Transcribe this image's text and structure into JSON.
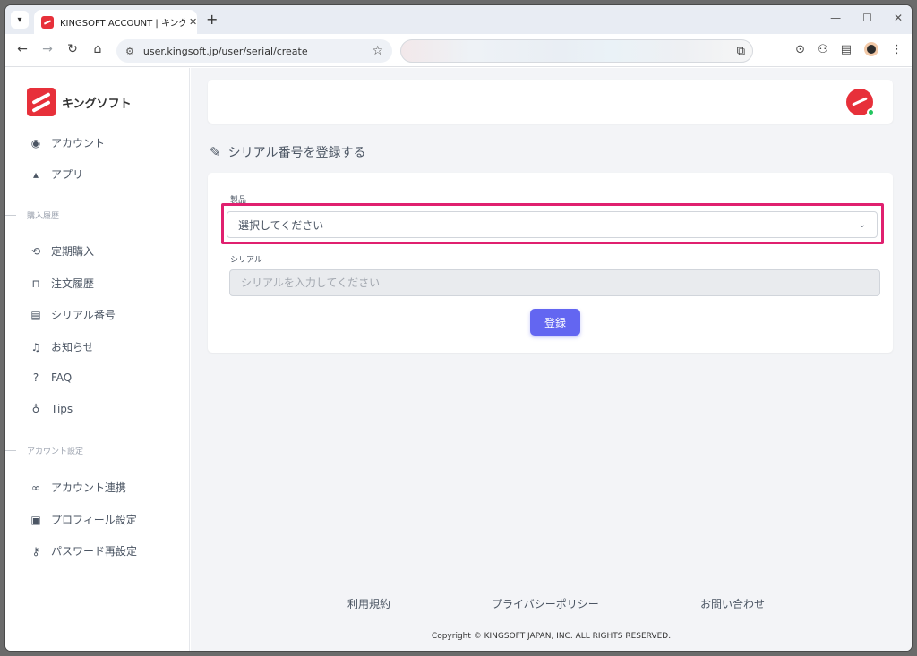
{
  "browser": {
    "tab_title": "KINGSOFT ACCOUNT | キングソフト",
    "url": "user.kingsoft.jp/user/serial/create"
  },
  "sidebar": {
    "brand": "キングソフト",
    "items_top": [
      {
        "label": "アカウント",
        "icon": "account-circle-icon"
      },
      {
        "label": "アプリ",
        "icon": "apps-shapes-icon"
      }
    ],
    "section_purchase": "購入履歴",
    "items_purchase": [
      {
        "label": "定期購入",
        "icon": "sync-icon"
      },
      {
        "label": "注文履歴",
        "icon": "shopping-bag-icon"
      },
      {
        "label": "シリアル番号",
        "icon": "document-icon"
      },
      {
        "label": "お知らせ",
        "icon": "bell-icon"
      },
      {
        "label": "FAQ",
        "icon": "question-icon"
      },
      {
        "label": "Tips",
        "icon": "lightbulb-icon"
      }
    ],
    "section_account": "アカウント設定",
    "items_account": [
      {
        "label": "アカウント連携",
        "icon": "link-icon"
      },
      {
        "label": "プロフィール設定",
        "icon": "profile-icon"
      },
      {
        "label": "パスワード再設定",
        "icon": "key-icon"
      }
    ]
  },
  "main": {
    "page_title": "シリアル番号を登録する",
    "form": {
      "product_label": "製品",
      "product_value": "選択してください",
      "serial_label": "シリアル",
      "serial_placeholder": "シリアルを入力してください",
      "submit_label": "登録"
    },
    "highlight_color": "#e0206f",
    "accent_color": "#6366f1"
  },
  "footer": {
    "links": [
      "利用規約",
      "プライバシーポリシー",
      "お問い合わせ"
    ],
    "copyright": "Copyright © KINGSOFT JAPAN, INC. ALL RIGHTS RESERVED."
  }
}
